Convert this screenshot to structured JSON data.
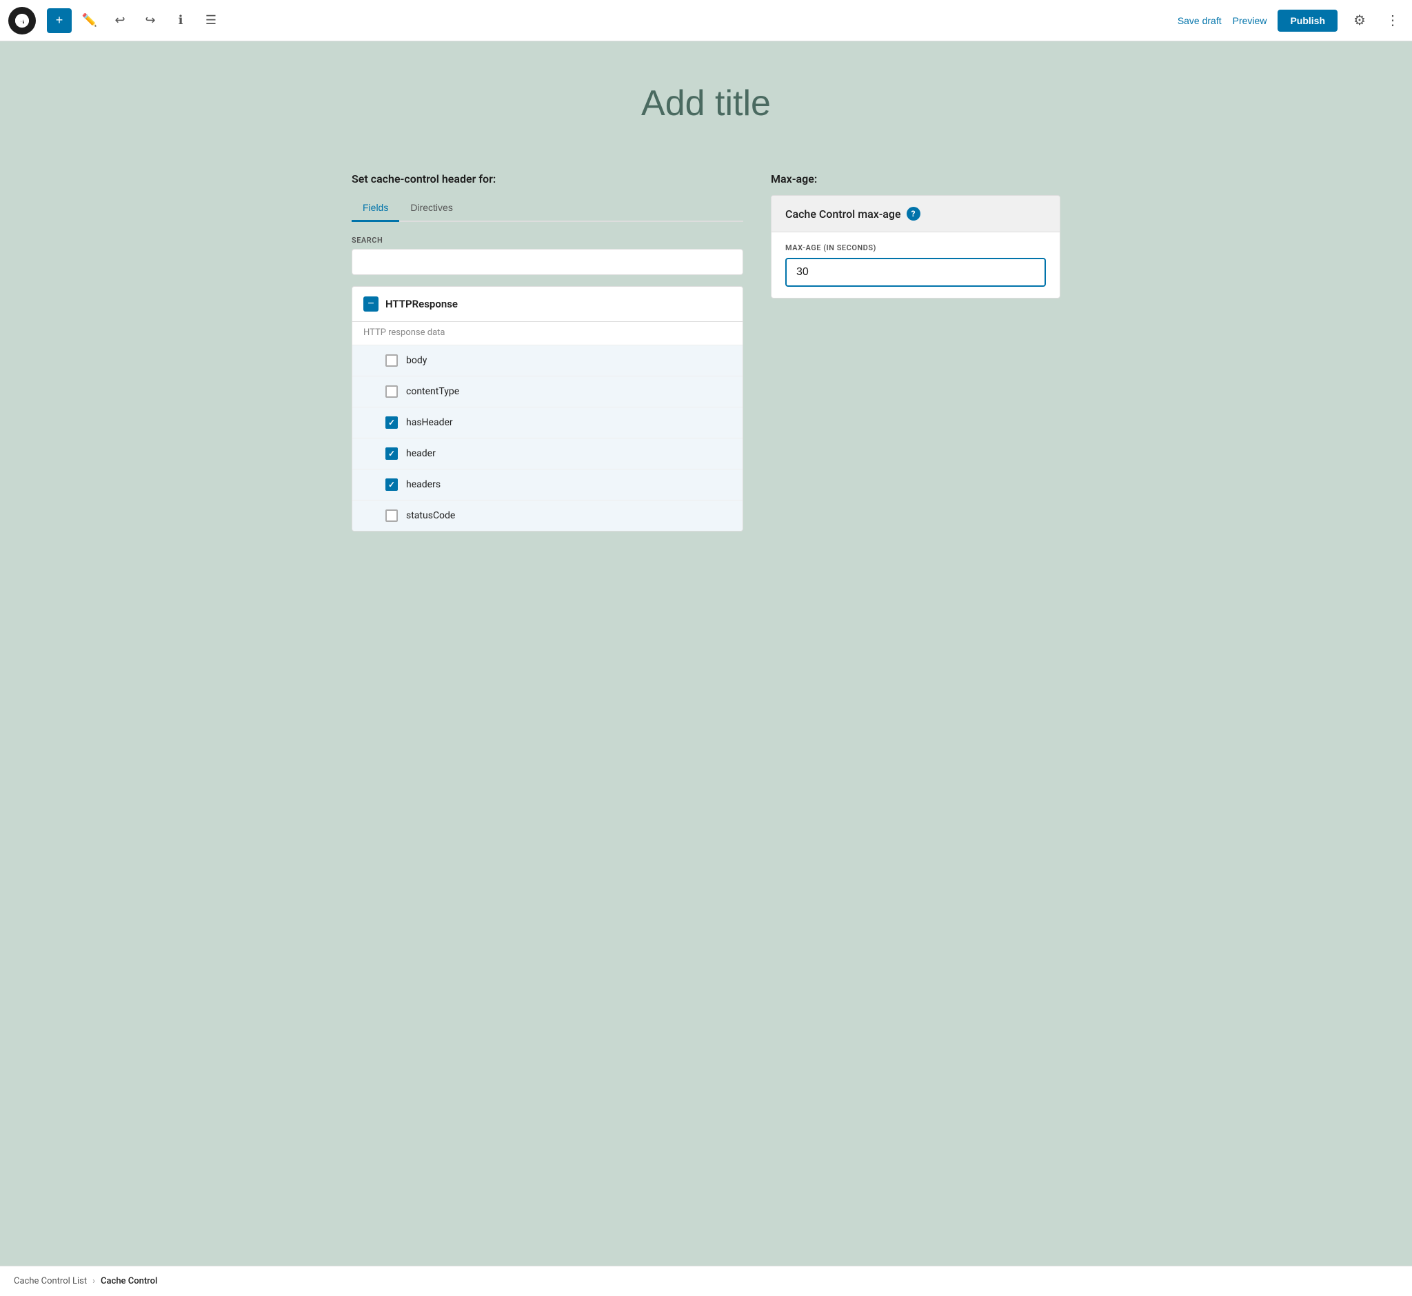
{
  "toolbar": {
    "add_label": "+",
    "save_draft_label": "Save draft",
    "preview_label": "Preview",
    "publish_label": "Publish"
  },
  "title_placeholder": "Add title",
  "left": {
    "section_label": "Set cache-control header for:",
    "tabs": [
      {
        "id": "fields",
        "label": "Fields",
        "active": true
      },
      {
        "id": "directives",
        "label": "Directives",
        "active": false
      }
    ],
    "search": {
      "label": "SEARCH",
      "placeholder": ""
    },
    "group": {
      "name": "HTTPResponse",
      "description": "HTTP response data",
      "fields": [
        {
          "id": "body",
          "label": "body",
          "checked": false
        },
        {
          "id": "contentType",
          "label": "contentType",
          "checked": false
        },
        {
          "id": "hasHeader",
          "label": "hasHeader",
          "checked": true
        },
        {
          "id": "header",
          "label": "header",
          "checked": true
        },
        {
          "id": "headers",
          "label": "headers",
          "checked": true
        },
        {
          "id": "statusCode",
          "label": "statusCode",
          "checked": false
        }
      ]
    }
  },
  "right": {
    "section_label": "Max-age:",
    "panel_title": "Cache Control max-age",
    "input_label": "MAX-AGE (IN SECONDS)",
    "input_value": "30"
  },
  "breadcrumb": {
    "parent": "Cache Control List",
    "current": "Cache Control"
  }
}
